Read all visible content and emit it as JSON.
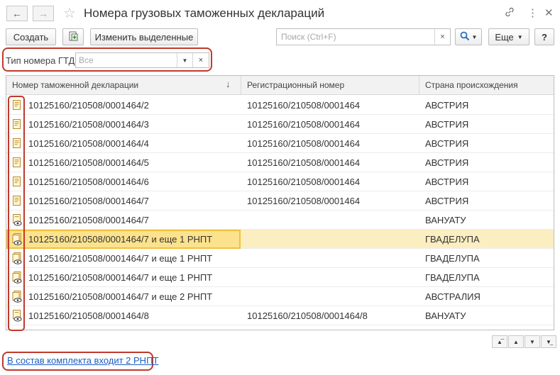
{
  "window": {
    "title": "Номера грузовых таможенных деклараций"
  },
  "icons": {
    "back": "arrow-left-icon",
    "forward": "arrow-right-icon",
    "favorite": "star-icon",
    "link": "link-icon",
    "menu": "kebab-icon",
    "close": "close-icon",
    "add": "add-copy-icon",
    "search": "search-icon"
  },
  "toolbar": {
    "create_label": "Создать",
    "edit_selected_label": "Изменить выделенные",
    "more_label": "Еще",
    "help_label": "?"
  },
  "search": {
    "placeholder": "Поиск (Ctrl+F)",
    "clear": "×"
  },
  "filter": {
    "label": "Тип номера ГТД:",
    "placeholder": "Все",
    "clear": "×"
  },
  "table": {
    "columns": [
      "Номер таможенной декларации",
      "Регистрационный номер",
      "Страна происхождения"
    ],
    "sort_indicator": "↓",
    "rows": [
      {
        "icon": "document-icon",
        "number": "10125160/210508/0001464/2",
        "reg": "10125160/210508/0001464",
        "country": "АВСТРИЯ"
      },
      {
        "icon": "document-icon",
        "number": "10125160/210508/0001464/3",
        "reg": "10125160/210508/0001464",
        "country": "АВСТРИЯ"
      },
      {
        "icon": "document-icon",
        "number": "10125160/210508/0001464/4",
        "reg": "10125160/210508/0001464",
        "country": "АВСТРИЯ"
      },
      {
        "icon": "document-icon",
        "number": "10125160/210508/0001464/5",
        "reg": "10125160/210508/0001464",
        "country": "АВСТРИЯ"
      },
      {
        "icon": "document-icon",
        "number": "10125160/210508/0001464/6",
        "reg": "10125160/210508/0001464",
        "country": "АВСТРИЯ"
      },
      {
        "icon": "document-icon",
        "number": "10125160/210508/0001464/7",
        "reg": "10125160/210508/0001464",
        "country": "АВСТРИЯ"
      },
      {
        "icon": "document-eye-icon",
        "number": "10125160/210508/0001464/7",
        "reg": "",
        "country": "ВАНУАТУ"
      },
      {
        "icon": "document-set-eye-icon",
        "number": "10125160/210508/0001464/7 и еще 1 РНПТ",
        "reg": "",
        "country": "ГВАДЕЛУПА",
        "selected": true
      },
      {
        "icon": "document-set-eye-icon",
        "number": "10125160/210508/0001464/7 и еще 1 РНПТ",
        "reg": "",
        "country": "ГВАДЕЛУПА"
      },
      {
        "icon": "document-set-eye-icon",
        "number": "10125160/210508/0001464/7 и еще 1 РНПТ",
        "reg": "",
        "country": "ГВАДЕЛУПА"
      },
      {
        "icon": "document-set-eye-icon",
        "number": "10125160/210508/0001464/7 и еще 2 РНПТ",
        "reg": "",
        "country": "АВСТРАЛИЯ"
      },
      {
        "icon": "document-eye-icon",
        "number": "10125160/210508/0001464/8",
        "reg": "10125160/210508/0001464/8",
        "country": "ВАНУАТУ"
      }
    ]
  },
  "pager": {
    "first": "first-page-icon",
    "prev": "prev-page-icon",
    "next": "next-page-icon",
    "last": "last-page-icon"
  },
  "footer": {
    "link_text": "В состав комплекта входит 2 РНПТ"
  },
  "colors": {
    "highlight_border": "#c0392b",
    "selection": "#fbeec1",
    "focus": "#fce28d",
    "link": "#1a5ec4"
  }
}
